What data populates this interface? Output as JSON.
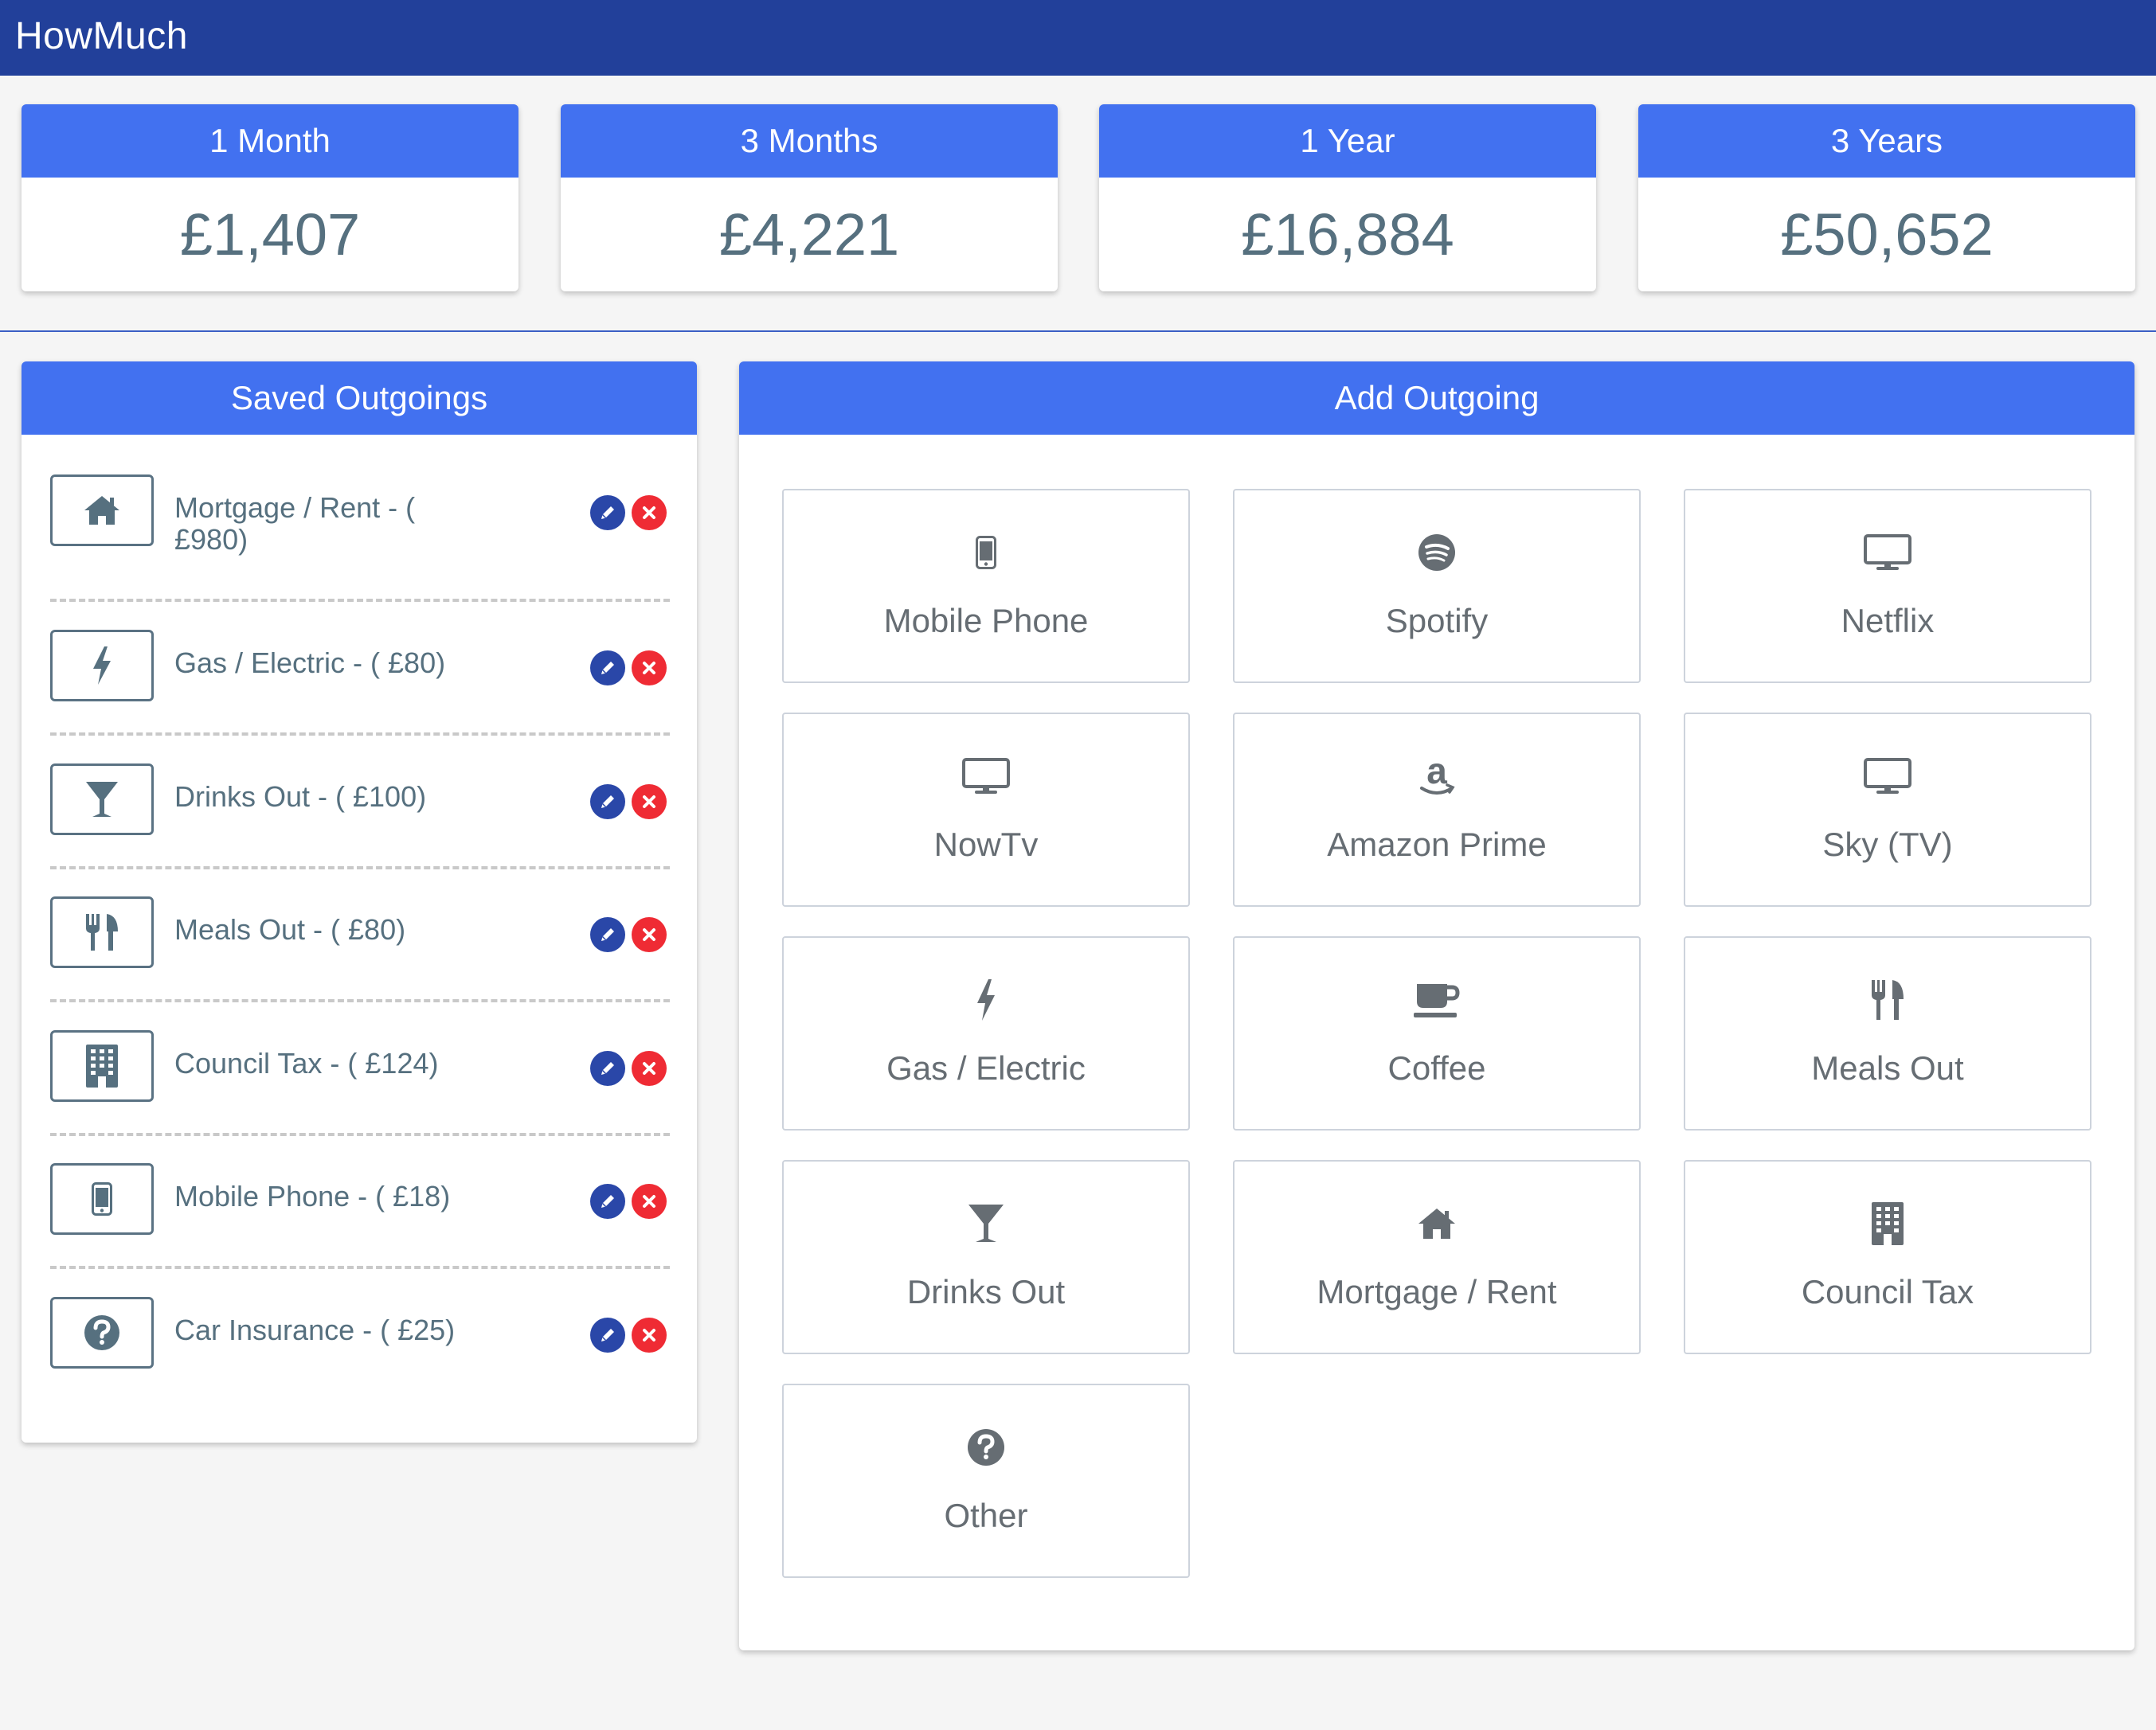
{
  "app": {
    "title": "HowMuch"
  },
  "summary": [
    {
      "label": "1 Month",
      "value": "£1,407"
    },
    {
      "label": "3 Months",
      "value": "£4,221"
    },
    {
      "label": "1 Year",
      "value": "£16,884"
    },
    {
      "label": "3 Years",
      "value": "£50,652"
    }
  ],
  "saved": {
    "title": "Saved Outgoings",
    "items": [
      {
        "text": "Mortgage / Rent - ( £980)",
        "icon": "home-icon"
      },
      {
        "text": "Gas / Electric - ( £80)",
        "icon": "lightning-icon"
      },
      {
        "text": "Drinks Out - ( £100)",
        "icon": "cocktail-icon"
      },
      {
        "text": "Meals Out - ( £80)",
        "icon": "cutlery-icon"
      },
      {
        "text": "Council Tax - ( £124)",
        "icon": "building-icon"
      },
      {
        "text": "Mobile Phone - ( £18)",
        "icon": "phone-icon"
      },
      {
        "text": "Car Insurance - ( £25)",
        "icon": "question-icon"
      }
    ]
  },
  "add": {
    "title": "Add Outgoing",
    "tiles": [
      {
        "label": "Mobile Phone",
        "icon": "phone-icon"
      },
      {
        "label": "Spotify",
        "icon": "spotify-icon"
      },
      {
        "label": "Netflix",
        "icon": "monitor-icon"
      },
      {
        "label": "NowTv",
        "icon": "monitor-icon"
      },
      {
        "label": "Amazon Prime",
        "icon": "amazon-icon"
      },
      {
        "label": "Sky (TV)",
        "icon": "monitor-icon"
      },
      {
        "label": "Gas / Electric",
        "icon": "lightning-icon"
      },
      {
        "label": "Coffee",
        "icon": "coffee-icon"
      },
      {
        "label": "Meals Out",
        "icon": "cutlery-icon"
      },
      {
        "label": "Drinks Out",
        "icon": "cocktail-icon"
      },
      {
        "label": "Mortgage / Rent",
        "icon": "home-icon"
      },
      {
        "label": "Council Tax",
        "icon": "building-icon"
      },
      {
        "label": "Other",
        "icon": "question-icon"
      }
    ]
  },
  "colors": {
    "topbar": "#22409a",
    "accent": "#4271f0",
    "edit": "#2a47a8",
    "delete": "#ef2b34"
  }
}
